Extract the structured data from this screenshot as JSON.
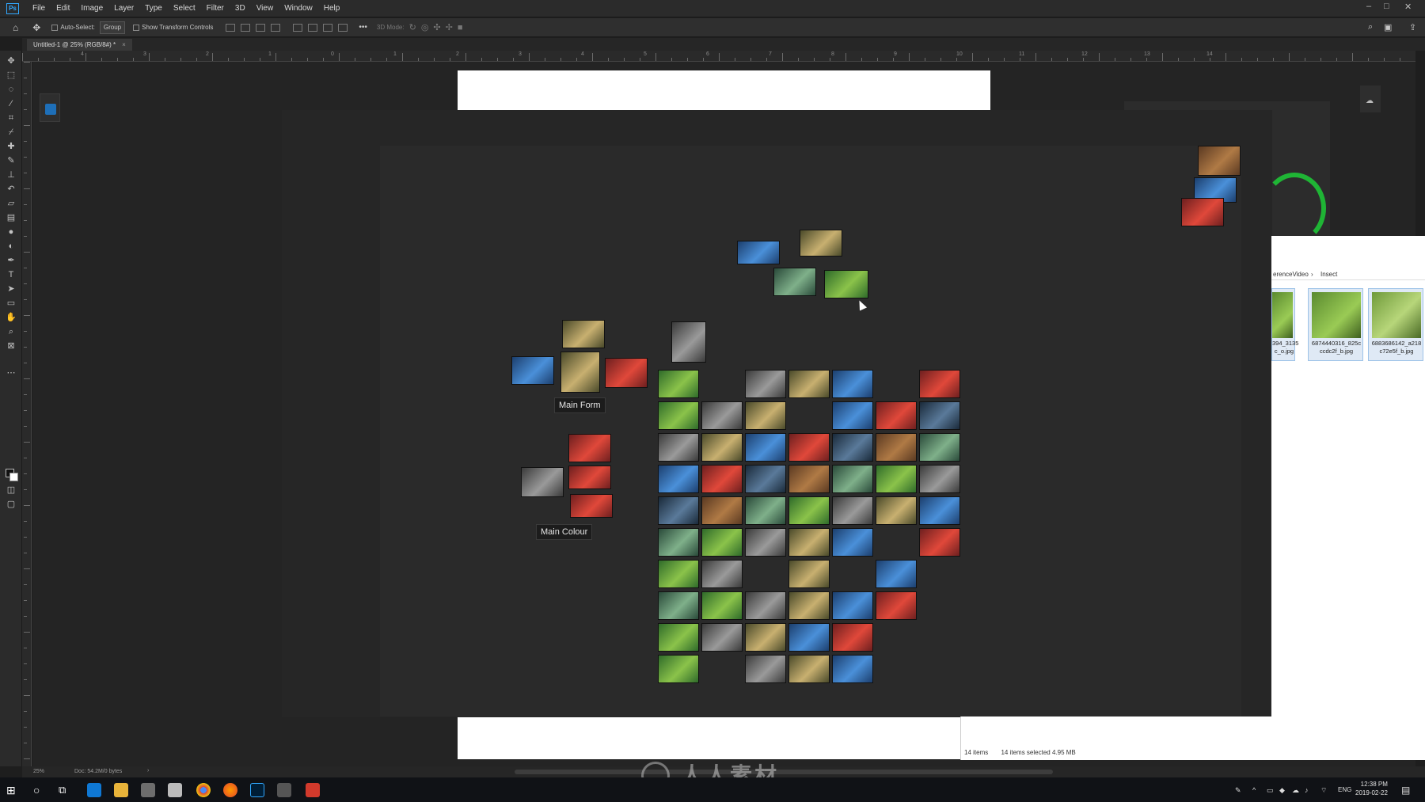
{
  "app": {
    "logo": "Ps",
    "menu": [
      "File",
      "Edit",
      "Image",
      "Layer",
      "Type",
      "Select",
      "Filter",
      "3D",
      "View",
      "Window",
      "Help"
    ],
    "window_controls": [
      "–",
      "□",
      "✕"
    ]
  },
  "options": {
    "auto_select_label": "Auto-Select:",
    "group_value": "Group",
    "show_transform_label": "Show Transform Controls",
    "mode_label": "3D Mode:",
    "more": "•••"
  },
  "document": {
    "tab_title": "Untitled-1 @ 25% (RGB/8#) *",
    "tab_close": "×"
  },
  "ruler": {
    "numbers": [
      "4",
      "3",
      "2",
      "1",
      "0",
      "1",
      "2",
      "3",
      "4",
      "5",
      "6",
      "7",
      "8",
      "9",
      "10",
      "11",
      "12",
      "13",
      "14"
    ]
  },
  "canvas": {
    "labels": {
      "main_form": "Main Form",
      "main_colour": "Main Colour"
    }
  },
  "explorer": {
    "breadcrumb_part1": "erenceVideo",
    "breadcrumb_sep": "›",
    "breadcrumb_part2": "Insect",
    "thumbs": [
      {
        "caption_line1": "394_3135",
        "caption_line2": "c_o.jpg"
      },
      {
        "caption_line1": "6874440316_825c",
        "caption_line2": "ccdc2f_b.jpg"
      },
      {
        "caption_line1": "6883686142_a218",
        "caption_line2": "c72e5f_b.jpg"
      }
    ],
    "items_count": "14 items",
    "selected_info": "14 items selected  4.95 MB"
  },
  "status": {
    "zoom": "25%",
    "doc_info": "Doc: 54.2M/0 bytes",
    "arrow": "›"
  },
  "taskbar": {
    "lang": "ENG",
    "time": "12:38 PM",
    "date": "2019-02-22"
  },
  "watermark": {
    "text": "人人素材"
  },
  "colors": {
    "accent": "#31a8ff",
    "canvas_bg": "#242424",
    "panel_bg": "#2b2b2b",
    "gauge_green": "#1fb535"
  }
}
